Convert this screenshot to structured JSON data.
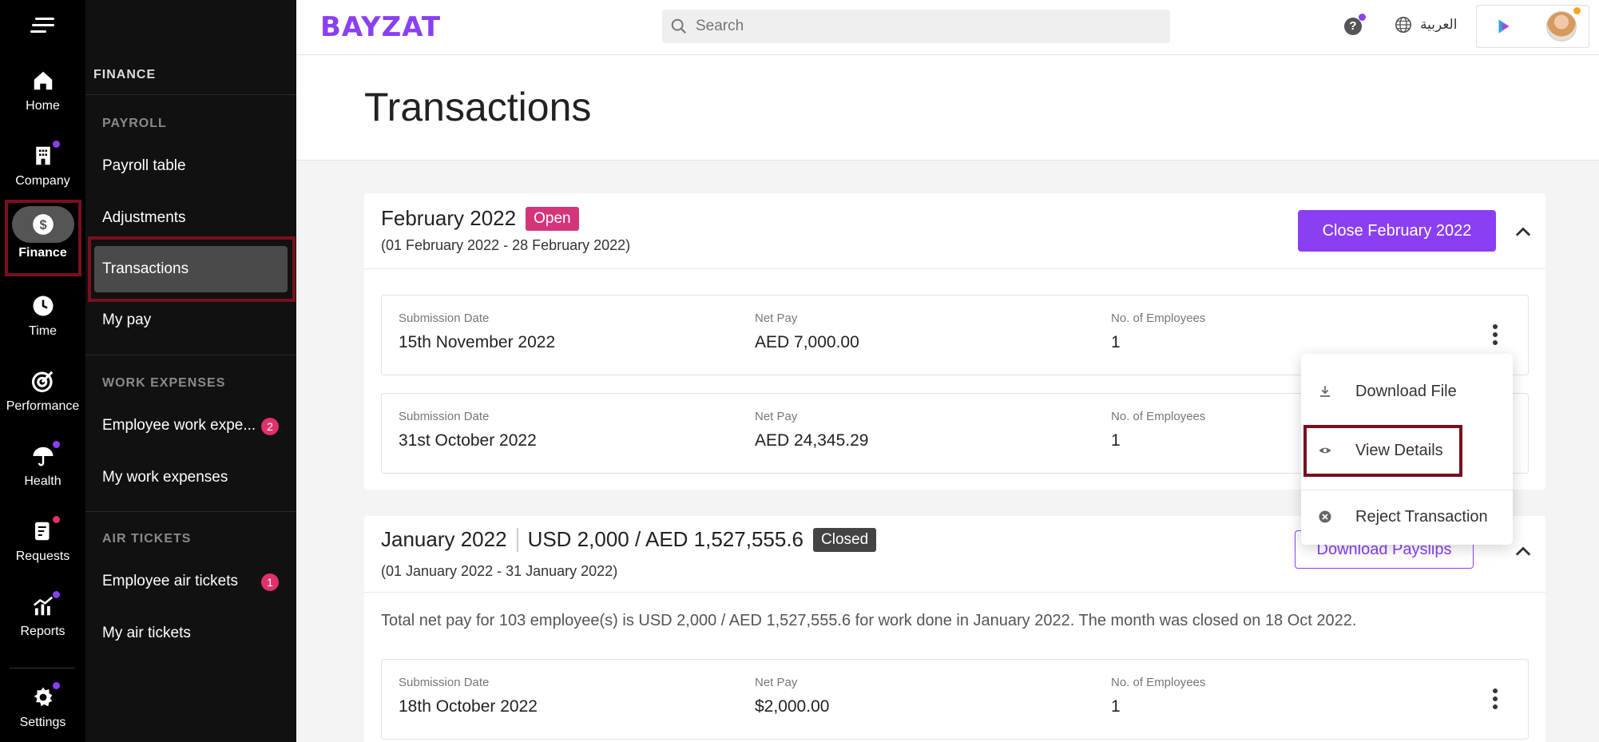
{
  "rail": {
    "items": [
      {
        "label": "Home",
        "icon": "home-icon"
      },
      {
        "label": "Company",
        "icon": "company-icon"
      },
      {
        "label": "Finance",
        "icon": "dollar-icon"
      },
      {
        "label": "Time",
        "icon": "clock-icon"
      },
      {
        "label": "Performance",
        "icon": "target-icon"
      },
      {
        "label": "Health",
        "icon": "umbrella-icon"
      },
      {
        "label": "Requests",
        "icon": "requests-icon"
      },
      {
        "label": "Reports",
        "icon": "reports-icon"
      },
      {
        "label": "Settings",
        "icon": "gear-icon"
      }
    ]
  },
  "sidebar": {
    "heading": "FINANCE",
    "payroll_section": "PAYROLL",
    "payroll_items": [
      "Payroll table",
      "Adjustments",
      "Transactions",
      "My pay"
    ],
    "work_expenses_section": "WORK EXPENSES",
    "work_expenses_items": [
      {
        "label": "Employee work expe...",
        "badge": "2"
      },
      {
        "label": "My work expenses"
      }
    ],
    "air_tickets_section": "AIR TICKETS",
    "air_tickets_items": [
      {
        "label": "Employee air tickets",
        "badge": "1"
      },
      {
        "label": "My air tickets"
      }
    ]
  },
  "topbar": {
    "logo": "BAYZAT",
    "search_placeholder": "Search",
    "help": "?",
    "language": "العربية"
  },
  "page": {
    "title": "Transactions"
  },
  "months": [
    {
      "title": "February 2022",
      "status": "Open",
      "range": "(01 February 2022 - 28 February 2022)",
      "action": "Close February 2022",
      "transactions": [
        {
          "submission_label": "Submission Date",
          "submission": "15th November 2022",
          "netpay_label": "Net Pay",
          "netpay": "AED 7,000.00",
          "employees_label": "No. of Employees",
          "employees": "1"
        },
        {
          "submission_label": "Submission Date",
          "submission": "31st October 2022",
          "netpay_label": "Net Pay",
          "netpay": "AED 24,345.29",
          "employees_label": "No. of Employees",
          "employees": "1"
        }
      ]
    },
    {
      "title": "January 2022",
      "amount": "USD 2,000 / AED 1,527,555.6",
      "status": "Closed",
      "range": "(01 January 2022 - 31 January 2022)",
      "action": "Download Payslips",
      "summary": "Total net pay for 103 employee(s) is USD 2,000 / AED 1,527,555.6 for work done in January 2022. The month was closed on 18 Oct 2022.",
      "transactions": [
        {
          "submission_label": "Submission Date",
          "submission": "18th October 2022",
          "netpay_label": "Net Pay",
          "netpay": "$2,000.00",
          "employees_label": "No. of Employees",
          "employees": "1"
        }
      ]
    }
  ],
  "dropdown": {
    "items": [
      {
        "label": "Download File",
        "icon": "download-icon"
      },
      {
        "label": "View Details",
        "icon": "eye-icon"
      },
      {
        "label": "Reject Transaction",
        "icon": "x-circle-icon"
      }
    ]
  },
  "colors": {
    "brand": "#8b3ff2",
    "open": "#d4357a",
    "closed": "#444444",
    "highlight": "#7a0f1f"
  }
}
